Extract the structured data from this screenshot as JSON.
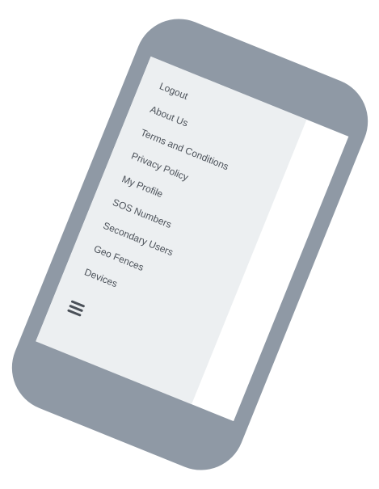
{
  "menu": {
    "items": [
      {
        "label": "Logout"
      },
      {
        "label": "About Us"
      },
      {
        "label": "Terms and Conditions"
      },
      {
        "label": "Privacy Policy"
      },
      {
        "label": "My Profile"
      },
      {
        "label": "SOS Numbers"
      },
      {
        "label": "Secondary Users"
      },
      {
        "label": "Geo Fences"
      },
      {
        "label": "Devices"
      }
    ]
  },
  "icons": {
    "menu_toggle": "hamburger-menu-icon"
  },
  "colors": {
    "phone_frame": "#8f99a5",
    "drawer_background": "#eceff1",
    "text": "#4b5159"
  }
}
